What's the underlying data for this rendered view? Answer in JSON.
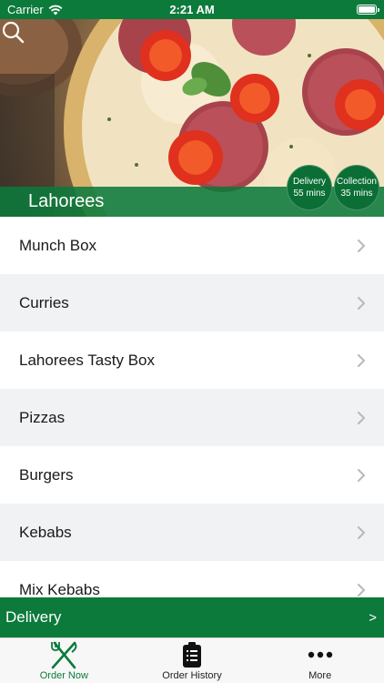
{
  "status_bar": {
    "carrier": "Carrier",
    "time": "2:21 AM"
  },
  "hero": {
    "restaurant_name": "Lahorees",
    "delivery": {
      "label": "Delivery",
      "time": "55 mins"
    },
    "collection": {
      "label": "Collection",
      "time": "35 mins"
    }
  },
  "menu": {
    "items": [
      {
        "label": "Munch Box"
      },
      {
        "label": "Curries"
      },
      {
        "label": "Lahorees Tasty Box"
      },
      {
        "label": "Pizzas"
      },
      {
        "label": "Burgers"
      },
      {
        "label": "Kebabs"
      },
      {
        "label": "Mix Kebabs"
      }
    ]
  },
  "order_mode": {
    "label": "Delivery",
    "arrow": ">"
  },
  "tab_bar": {
    "tabs": [
      {
        "label": "Order Now",
        "icon": "fork-knife-icon",
        "active": true
      },
      {
        "label": "Order History",
        "icon": "clipboard-icon",
        "active": false
      },
      {
        "label": "More",
        "icon": "more-dots-icon",
        "active": false
      }
    ]
  },
  "colors": {
    "brand_green": "#0b7a3b",
    "list_alt_bg": "#f1f2f4",
    "tab_bar_bg": "#f7f7f7"
  }
}
